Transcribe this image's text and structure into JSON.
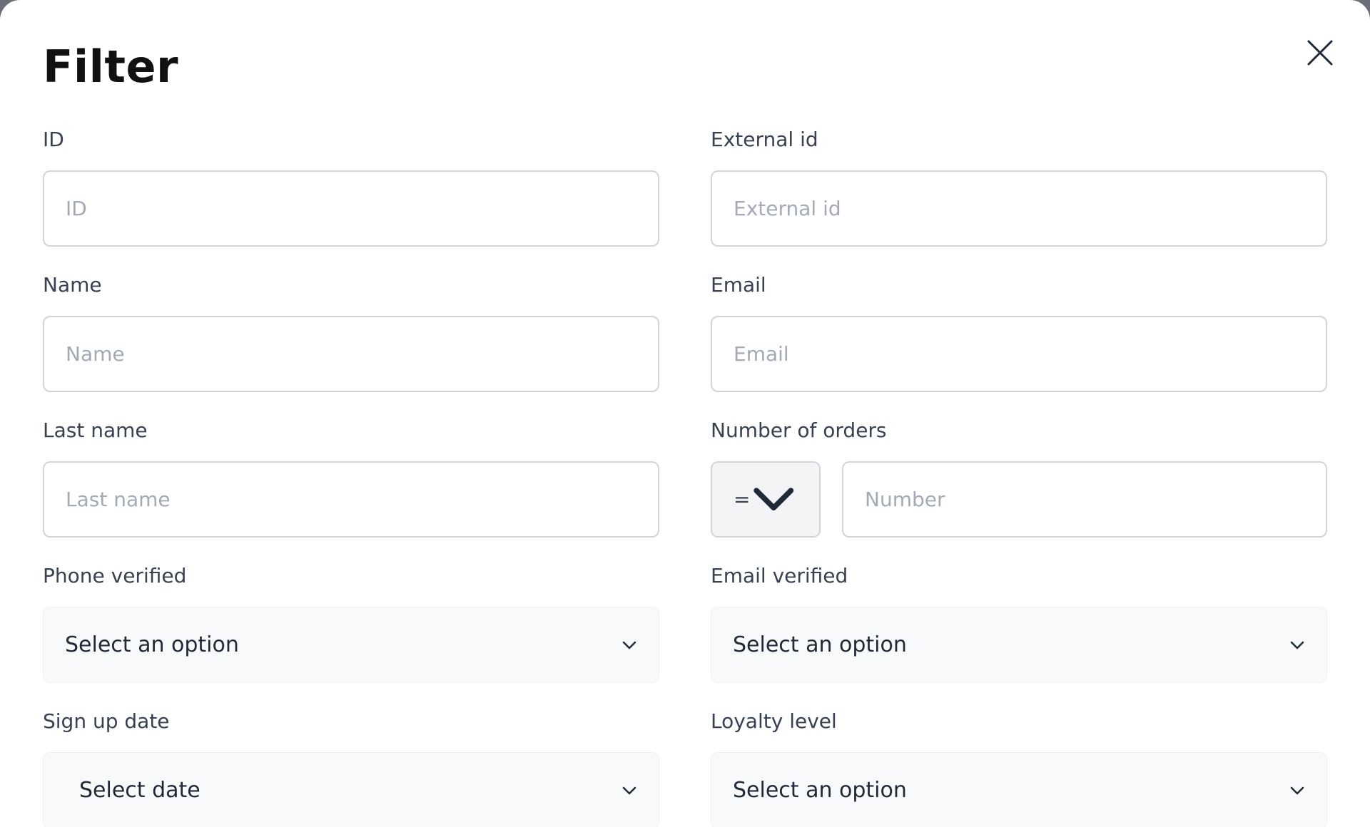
{
  "dialog": {
    "title": "Filter",
    "close_icon": "close-icon"
  },
  "fields": {
    "id": {
      "label": "ID",
      "placeholder": "ID"
    },
    "external_id": {
      "label": "External id",
      "placeholder": "External id"
    },
    "name": {
      "label": "Name",
      "placeholder": "Name"
    },
    "email": {
      "label": "Email",
      "placeholder": "Email"
    },
    "last_name": {
      "label": "Last name",
      "placeholder": "Last name"
    },
    "number_of_orders": {
      "label": "Number of orders",
      "operator": "=",
      "placeholder": "Number"
    },
    "phone_verified": {
      "label": "Phone verified",
      "value": "Select an option"
    },
    "email_verified": {
      "label": "Email verified",
      "value": "Select an option"
    },
    "sign_up_date": {
      "label": "Sign up date",
      "value": "Select date"
    },
    "loyalty_level": {
      "label": "Loyalty level",
      "value": "Select an option"
    }
  },
  "colors": {
    "input_border": "#d1d5db",
    "select_background": "#f8f9fb",
    "placeholder": "#a3aab6",
    "label": "#374151"
  }
}
